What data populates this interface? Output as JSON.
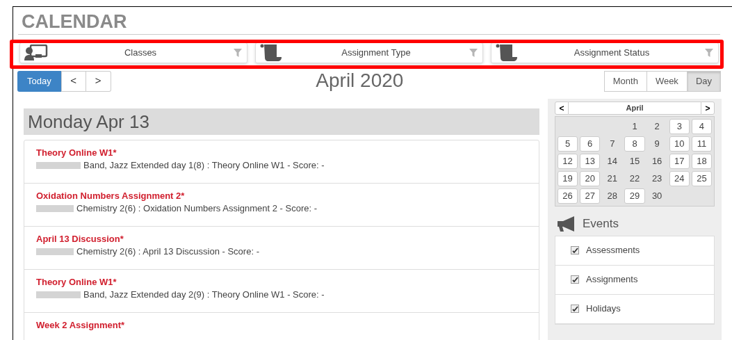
{
  "page_title": "CALENDAR",
  "filters": [
    {
      "kind": "classes",
      "label": "Classes"
    },
    {
      "kind": "scroll",
      "label": "Assignment Type"
    },
    {
      "kind": "scroll",
      "label": "Assignment Status"
    }
  ],
  "toolbar": {
    "today": "Today",
    "prev": "<",
    "next": ">",
    "title": "April 2020",
    "views": [
      {
        "label": "Month",
        "selected": false
      },
      {
        "label": "Week",
        "selected": false
      },
      {
        "label": "Day",
        "selected": true
      }
    ]
  },
  "day_heading": "Monday Apr 13",
  "events": [
    {
      "title": "Theory Online W1*",
      "detail": "Band, Jazz Extended day 1(8) : Theory Online W1 - Score: -"
    },
    {
      "title": "Oxidation Numbers Assignment 2*",
      "detail": "Chemistry 2(6) : Oxidation Numbers Assignment 2 - Score: -"
    },
    {
      "title": "April 13 Discussion*",
      "detail": "Chemistry 2(6) : April 13 Discussion - Score: -"
    },
    {
      "title": "Theory Online W1*",
      "detail": "Band, Jazz Extended day 2(9) : Theory Online W1 - Score: -"
    },
    {
      "title": "Week 2 Assignment*"
    }
  ],
  "mini_calendar": {
    "prev": "<",
    "month": "April",
    "next": ">",
    "days": [
      {
        "label": "1",
        "marked": false
      },
      {
        "label": "2",
        "marked": false
      },
      {
        "label": "3",
        "marked": true
      },
      {
        "label": "4",
        "marked": true
      },
      {
        "label": "5",
        "marked": true
      },
      {
        "label": "6",
        "marked": true
      },
      {
        "label": "7",
        "marked": false
      },
      {
        "label": "8",
        "marked": true
      },
      {
        "label": "9",
        "marked": false
      },
      {
        "label": "10",
        "marked": true
      },
      {
        "label": "11",
        "marked": true
      },
      {
        "label": "12",
        "marked": true
      },
      {
        "label": "13",
        "marked": true
      },
      {
        "label": "14",
        "marked": false
      },
      {
        "label": "15",
        "marked": false
      },
      {
        "label": "16",
        "marked": false
      },
      {
        "label": "17",
        "marked": true
      },
      {
        "label": "18",
        "marked": true
      },
      {
        "label": "19",
        "marked": true
      },
      {
        "label": "20",
        "marked": true
      },
      {
        "label": "21",
        "marked": false
      },
      {
        "label": "22",
        "marked": false
      },
      {
        "label": "23",
        "marked": false
      },
      {
        "label": "24",
        "marked": true
      },
      {
        "label": "25",
        "marked": true
      },
      {
        "label": "26",
        "marked": true
      },
      {
        "label": "27",
        "marked": true
      },
      {
        "label": "28",
        "marked": false
      },
      {
        "label": "29",
        "marked": true
      },
      {
        "label": "30",
        "marked": false
      }
    ]
  },
  "events_panel": {
    "title": "Events",
    "items": [
      {
        "label": "Assessments",
        "checked": true
      },
      {
        "label": "Assignments",
        "checked": true
      },
      {
        "label": "Holidays",
        "checked": true
      }
    ]
  }
}
